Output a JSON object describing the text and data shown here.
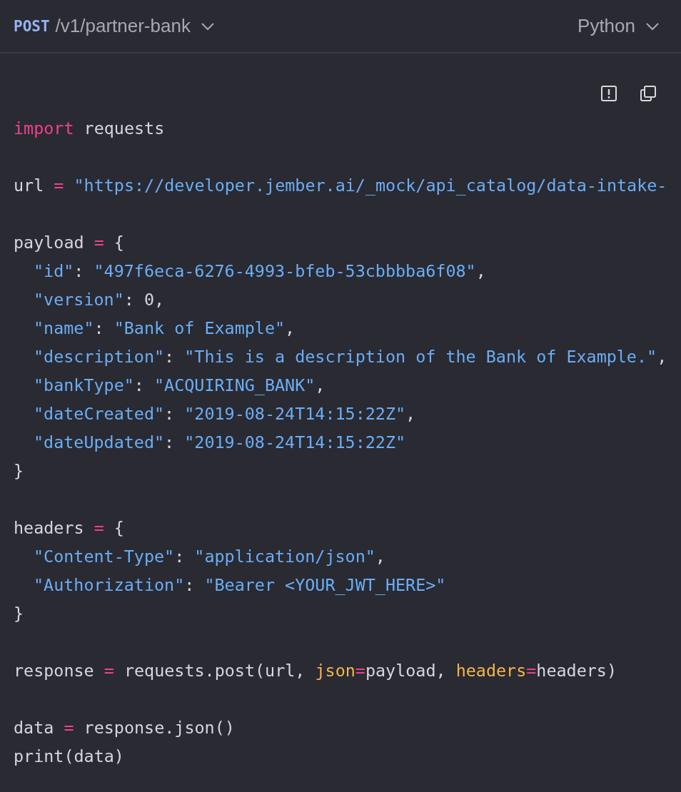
{
  "header": {
    "endpoint": {
      "method": "POST",
      "path": "/v1/partner-bank"
    },
    "language": {
      "label": "Python"
    }
  },
  "code": {
    "lines": [
      {
        "kind": "code",
        "indented": false,
        "tokens": [
          {
            "kind": "keyword",
            "text": "import"
          },
          {
            "kind": "plain",
            "text": " requests"
          }
        ]
      },
      {
        "kind": "blank"
      },
      {
        "kind": "code",
        "indented": false,
        "tokens": [
          {
            "kind": "plain",
            "text": "url "
          },
          {
            "kind": "op",
            "text": "="
          },
          {
            "kind": "string",
            "text": " \"https://developer.jember.ai/_mock/api_catalog/data-intake-"
          }
        ]
      },
      {
        "kind": "blank"
      },
      {
        "kind": "code",
        "indented": false,
        "tokens": [
          {
            "kind": "plain",
            "text": "payload "
          },
          {
            "kind": "op",
            "text": "="
          },
          {
            "kind": "plain",
            "text": " {"
          }
        ]
      },
      {
        "kind": "code",
        "indented": true,
        "tokens": [
          {
            "kind": "string",
            "text": "\"id\""
          },
          {
            "kind": "plain",
            "text": ": "
          },
          {
            "kind": "string",
            "text": "\"497f6eca-6276-4993-bfeb-53cbbbba6f08\""
          },
          {
            "kind": "plain",
            "text": ","
          }
        ]
      },
      {
        "kind": "code",
        "indented": true,
        "tokens": [
          {
            "kind": "string",
            "text": "\"version\""
          },
          {
            "kind": "plain",
            "text": ": 0,"
          }
        ]
      },
      {
        "kind": "code",
        "indented": true,
        "tokens": [
          {
            "kind": "string",
            "text": "\"name\""
          },
          {
            "kind": "plain",
            "text": ": "
          },
          {
            "kind": "string",
            "text": "\"Bank of Example\""
          },
          {
            "kind": "plain",
            "text": ","
          }
        ]
      },
      {
        "kind": "code",
        "indented": true,
        "tokens": [
          {
            "kind": "string",
            "text": "\"description\""
          },
          {
            "kind": "plain",
            "text": ": "
          },
          {
            "kind": "string",
            "text": "\"This is a description of the Bank of Example.\""
          },
          {
            "kind": "plain",
            "text": ","
          }
        ]
      },
      {
        "kind": "code",
        "indented": true,
        "tokens": [
          {
            "kind": "string",
            "text": "\"bankType\""
          },
          {
            "kind": "plain",
            "text": ": "
          },
          {
            "kind": "string",
            "text": "\"ACQUIRING_BANK\""
          },
          {
            "kind": "plain",
            "text": ","
          }
        ]
      },
      {
        "kind": "code",
        "indented": true,
        "tokens": [
          {
            "kind": "string",
            "text": "\"dateCreated\""
          },
          {
            "kind": "plain",
            "text": ": "
          },
          {
            "kind": "string",
            "text": "\"2019-08-24T14:15:22Z\""
          },
          {
            "kind": "plain",
            "text": ","
          }
        ]
      },
      {
        "kind": "code",
        "indented": true,
        "tokens": [
          {
            "kind": "string",
            "text": "\"dateUpdated\""
          },
          {
            "kind": "plain",
            "text": ": "
          },
          {
            "kind": "string",
            "text": "\"2019-08-24T14:15:22Z\""
          }
        ]
      },
      {
        "kind": "code",
        "indented": false,
        "tokens": [
          {
            "kind": "plain",
            "text": "}"
          }
        ]
      },
      {
        "kind": "blank"
      },
      {
        "kind": "code",
        "indented": false,
        "tokens": [
          {
            "kind": "plain",
            "text": "headers "
          },
          {
            "kind": "op",
            "text": "="
          },
          {
            "kind": "plain",
            "text": " {"
          }
        ]
      },
      {
        "kind": "code",
        "indented": true,
        "tokens": [
          {
            "kind": "string",
            "text": "\"Content-Type\""
          },
          {
            "kind": "plain",
            "text": ": "
          },
          {
            "kind": "string",
            "text": "\"application/json\""
          },
          {
            "kind": "plain",
            "text": ","
          }
        ]
      },
      {
        "kind": "code",
        "indented": true,
        "tokens": [
          {
            "kind": "string",
            "text": "\"Authorization\""
          },
          {
            "kind": "plain",
            "text": ": "
          },
          {
            "kind": "string",
            "text": "\"Bearer <YOUR_JWT_HERE>\""
          }
        ]
      },
      {
        "kind": "code",
        "indented": false,
        "tokens": [
          {
            "kind": "plain",
            "text": "}"
          }
        ]
      },
      {
        "kind": "blank"
      },
      {
        "kind": "code",
        "indented": false,
        "tokens": [
          {
            "kind": "plain",
            "text": "response "
          },
          {
            "kind": "op",
            "text": "="
          },
          {
            "kind": "plain",
            "text": " requests.post(url, "
          },
          {
            "kind": "param",
            "text": "json"
          },
          {
            "kind": "op",
            "text": "="
          },
          {
            "kind": "plain",
            "text": "payload, "
          },
          {
            "kind": "param",
            "text": "headers"
          },
          {
            "kind": "op",
            "text": "="
          },
          {
            "kind": "plain",
            "text": "headers)"
          }
        ]
      },
      {
        "kind": "blank"
      },
      {
        "kind": "code",
        "indented": false,
        "tokens": [
          {
            "kind": "plain",
            "text": "data "
          },
          {
            "kind": "op",
            "text": "="
          },
          {
            "kind": "plain",
            "text": " response.json()"
          }
        ]
      },
      {
        "kind": "code",
        "indented": false,
        "tokens": [
          {
            "kind": "plain",
            "text": "print(data)"
          }
        ]
      }
    ]
  }
}
